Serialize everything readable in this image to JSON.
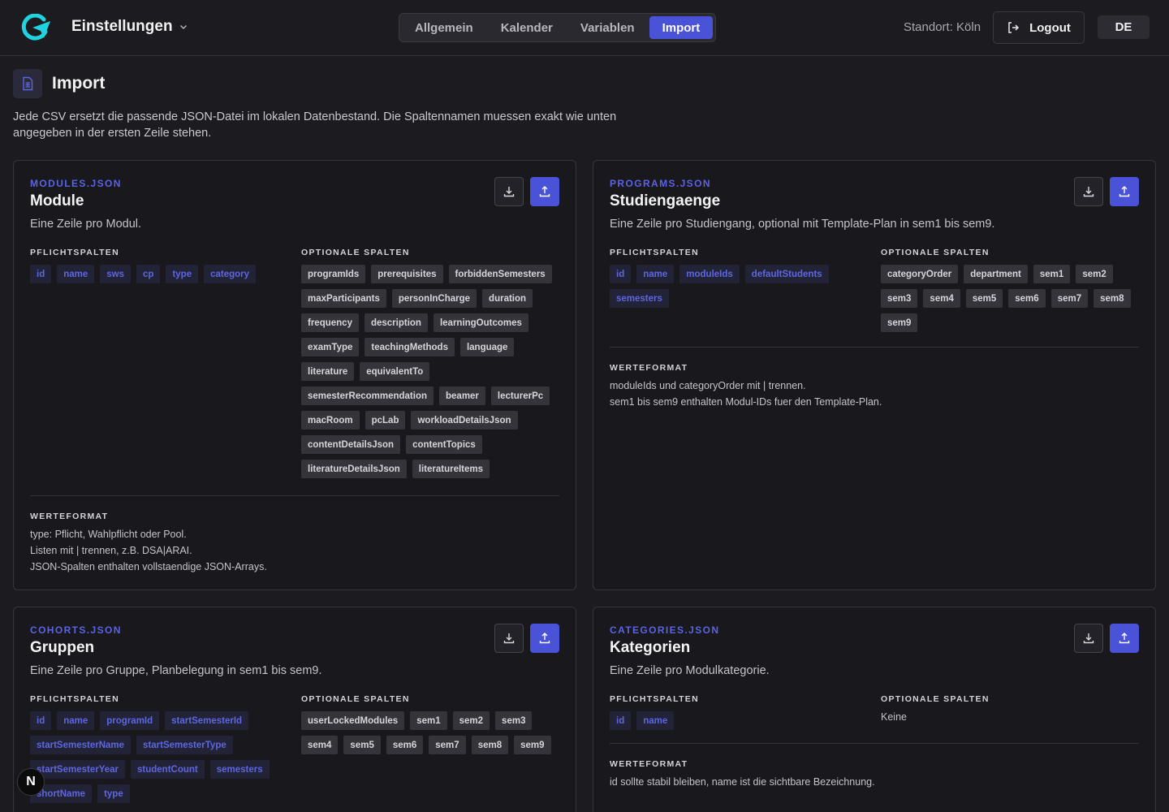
{
  "header": {
    "title": "Einstellungen",
    "tabs": [
      {
        "label": "Allgemein",
        "active": false
      },
      {
        "label": "Kalender",
        "active": false
      },
      {
        "label": "Variablen",
        "active": false
      },
      {
        "label": "Import",
        "active": true
      }
    ],
    "location": "Standort: Köln",
    "logout_label": "Logout",
    "language": "DE"
  },
  "page": {
    "title": "Import",
    "description": "Jede CSV ersetzt die passende JSON-Datei im lokalen Datenbestand. Die Spaltennamen muessen exakt wie unten angegeben in der ersten Zeile stehen."
  },
  "labels": {
    "required": "PFLICHTSPALTEN",
    "optional": "OPTIONALE SPALTEN",
    "format": "WERTEFORMAT"
  },
  "cards": {
    "modules": {
      "key": "MODULES.JSON",
      "title": "Module",
      "description": "Eine Zeile pro Modul.",
      "required": [
        "id",
        "name",
        "sws",
        "cp",
        "type",
        "category"
      ],
      "optional": [
        "programIds",
        "prerequisites",
        "forbiddenSemesters",
        "maxParticipants",
        "personInCharge",
        "duration",
        "frequency",
        "description",
        "learningOutcomes",
        "examType",
        "teachingMethods",
        "language",
        "literature",
        "equivalentTo",
        "semesterRecommendation",
        "beamer",
        "lecturerPc",
        "macRoom",
        "pcLab",
        "workloadDetailsJson",
        "contentDetailsJson",
        "contentTopics",
        "literatureDetailsJson",
        "literatureItems"
      ],
      "format": [
        "type: Pflicht, Wahlpflicht oder Pool.",
        "Listen mit | trennen, z.B. DSA|ARAI.",
        "JSON-Spalten enthalten vollstaendige JSON-Arrays."
      ]
    },
    "programs": {
      "key": "PROGRAMS.JSON",
      "title": "Studiengaenge",
      "description": "Eine Zeile pro Studiengang, optional mit Template-Plan in sem1 bis sem9.",
      "required": [
        "id",
        "name",
        "moduleIds",
        "defaultStudents",
        "semesters"
      ],
      "optional": [
        "categoryOrder",
        "department",
        "sem1",
        "sem2",
        "sem3",
        "sem4",
        "sem5",
        "sem6",
        "sem7",
        "sem8",
        "sem9"
      ],
      "format": [
        "moduleIds und categoryOrder mit | trennen.",
        "sem1 bis sem9 enthalten Modul-IDs fuer den Template-Plan."
      ]
    },
    "cohorts": {
      "key": "COHORTS.JSON",
      "title": "Gruppen",
      "description": "Eine Zeile pro Gruppe, Planbelegung in sem1 bis sem9.",
      "required": [
        "id",
        "name",
        "programId",
        "startSemesterId",
        "startSemesterName",
        "startSemesterType",
        "startSemesterYear",
        "studentCount",
        "semesters",
        "shortName",
        "type"
      ],
      "optional": [
        "userLockedModules",
        "sem1",
        "sem2",
        "sem3",
        "sem4",
        "sem5",
        "sem6",
        "sem7",
        "sem8",
        "sem9"
      ]
    },
    "categories": {
      "key": "CATEGORIES.JSON",
      "title": "Kategorien",
      "description": "Eine Zeile pro Modulkategorie.",
      "required": [
        "id",
        "name"
      ],
      "optional_none": "Keine",
      "format": [
        "id sollte stabil bleiben, name ist die sichtbare Bezeichnung."
      ]
    }
  },
  "badge": "N",
  "colors": {
    "accent": "#4a52d8",
    "background": "#1c1b1f",
    "card": "#19181c"
  }
}
